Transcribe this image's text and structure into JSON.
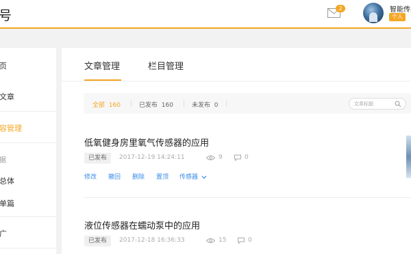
{
  "header": {
    "brand_tail": "号",
    "mail_badge": "2",
    "user_name": "智能传感",
    "user_tag": "个人"
  },
  "sidebar": {
    "items": [
      {
        "label": "页",
        "state": "normal"
      },
      {
        "label": "文章",
        "state": "normal"
      },
      {
        "label": "容管理",
        "state": "active"
      },
      {
        "label": "据",
        "state": "group"
      },
      {
        "label": "总体",
        "state": "normal"
      },
      {
        "label": "单篇",
        "state": "normal"
      },
      {
        "label": "广",
        "state": "normal"
      }
    ]
  },
  "tabs": [
    {
      "label": "文章管理",
      "active": true
    },
    {
      "label": "栏目管理",
      "active": false
    }
  ],
  "filters": [
    {
      "label": "全部",
      "count": "160",
      "active": true
    },
    {
      "label": "已发布",
      "count": "160",
      "active": false
    },
    {
      "label": "未发布",
      "count": "0",
      "active": false
    }
  ],
  "search": {
    "placeholder": "文章标题"
  },
  "articles": [
    {
      "title": "低氧健身房里氧气传感器的应用",
      "status": "已发布",
      "date": "2017-12-19 14:24:11",
      "views": "9",
      "comments": "0",
      "actions": [
        "修改",
        "撤回",
        "删除",
        "置顶",
        "传感器"
      ]
    },
    {
      "title": "液位传感器在蠕动泵中的应用",
      "status": "已发布",
      "date": "2017-12-18 16:36:33",
      "views": "15",
      "comments": "0"
    }
  ],
  "colors": {
    "accent": "#f5a623",
    "link": "#3a8ee6"
  }
}
